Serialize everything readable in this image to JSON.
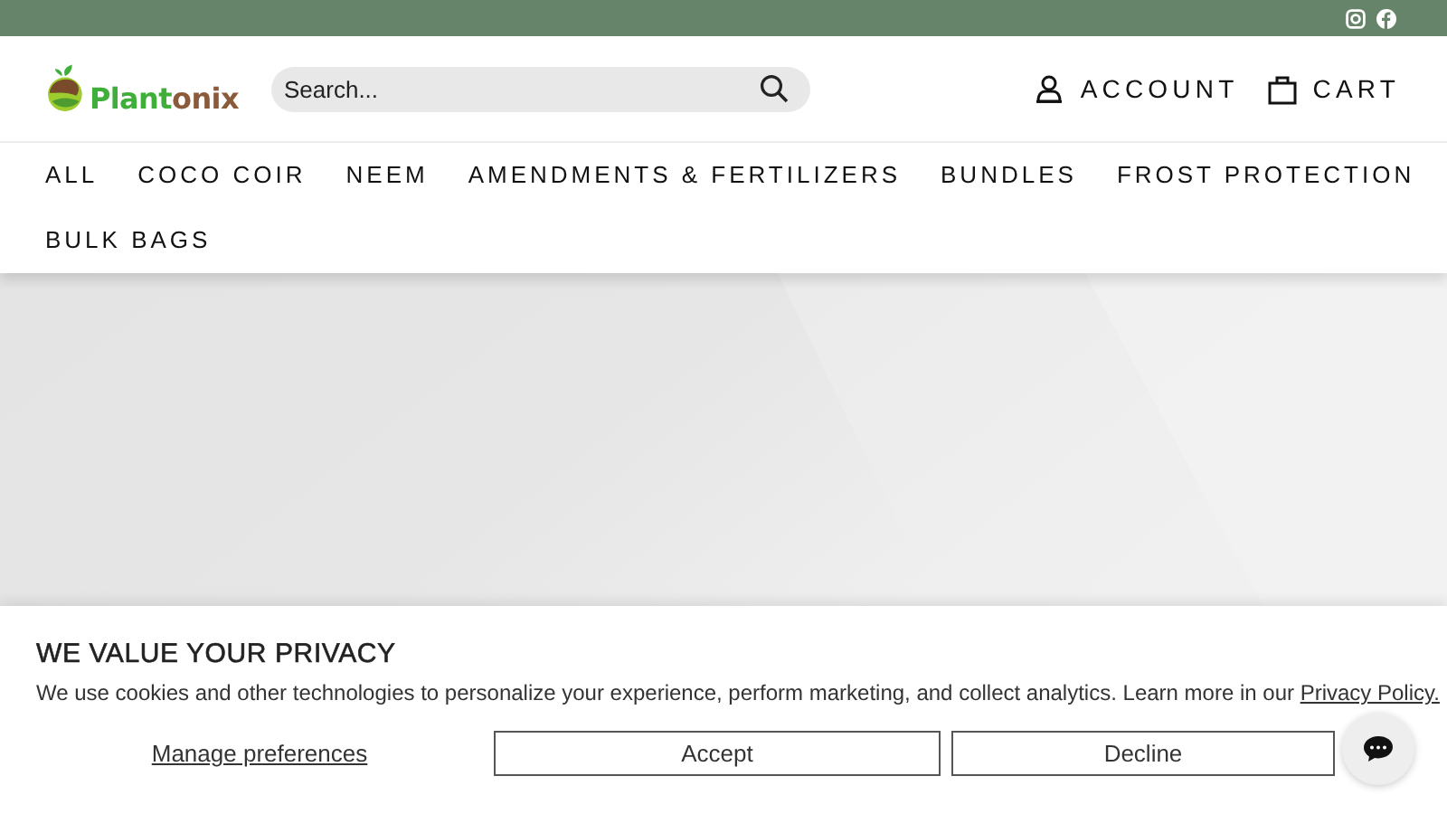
{
  "header": {
    "logo": {
      "plant": "Plant",
      "onix": "onix"
    },
    "search": {
      "placeholder": "Search..."
    },
    "account": "ACCOUNT",
    "cart": "CART"
  },
  "nav": [
    "ALL",
    "COCO COIR",
    "NEEM",
    "AMENDMENTS & FERTILIZERS",
    "BUNDLES",
    "FROST PROTECTION",
    "BULK BAGS"
  ],
  "privacy": {
    "title": "WE VALUE YOUR PRIVACY",
    "text": "We use cookies and other technologies to personalize your experience, perform marketing, and collect analytics. Learn more in our",
    "link": "Privacy Policy.",
    "manage": "Manage preferences",
    "accept": "Accept",
    "decline": "Decline"
  }
}
